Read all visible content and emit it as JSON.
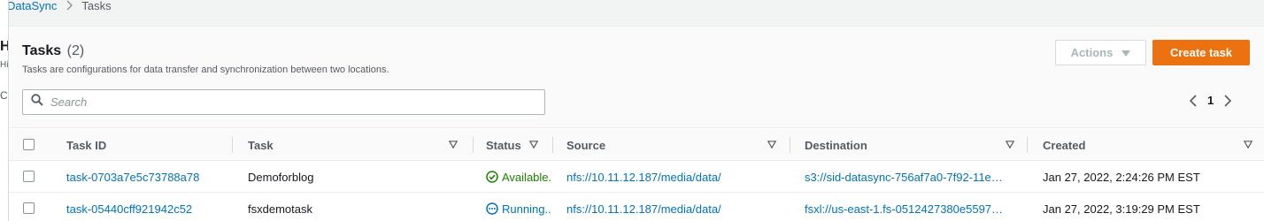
{
  "breadcrumb": {
    "root": "DataSync",
    "current": "Tasks"
  },
  "left_fragments": {
    "h": "H",
    "hi": "Hi",
    "c": "C"
  },
  "panel": {
    "title": "Tasks",
    "count": "(2)",
    "description": "Tasks are configurations for data transfer and synchronization between two locations."
  },
  "actions": {
    "actions_label": "Actions",
    "create_label": "Create task"
  },
  "search": {
    "placeholder": "Search"
  },
  "pagination": {
    "current_page": "1"
  },
  "table": {
    "columns": {
      "task_id": "Task ID",
      "task": "Task",
      "status": "Status",
      "source": "Source",
      "destination": "Destination",
      "created": "Created"
    },
    "rows": [
      {
        "task_id": "task-0703a7e5c73788a78",
        "task": "Demoforblog",
        "status": "Available.",
        "source": "nfs://10.11.12.187/media/data/",
        "destination": "s3://sid-datasync-756af7a0-7f92-11e…",
        "created": "Jan 27, 2022, 2:24:26 PM EST"
      },
      {
        "task_id": "task-05440cff921942c52",
        "task": "fsxdemotask",
        "status": "Running..",
        "source": "nfs://10.11.12.187/media/data/",
        "destination": "fsxl://us-east-1.fs-0512427380e5597…",
        "created": "Jan 27, 2022, 3:19:29 PM EST"
      }
    ]
  },
  "colors": {
    "accent_orange": "#ec7211",
    "link_blue": "#0073bb",
    "success_green": "#1d8102"
  }
}
